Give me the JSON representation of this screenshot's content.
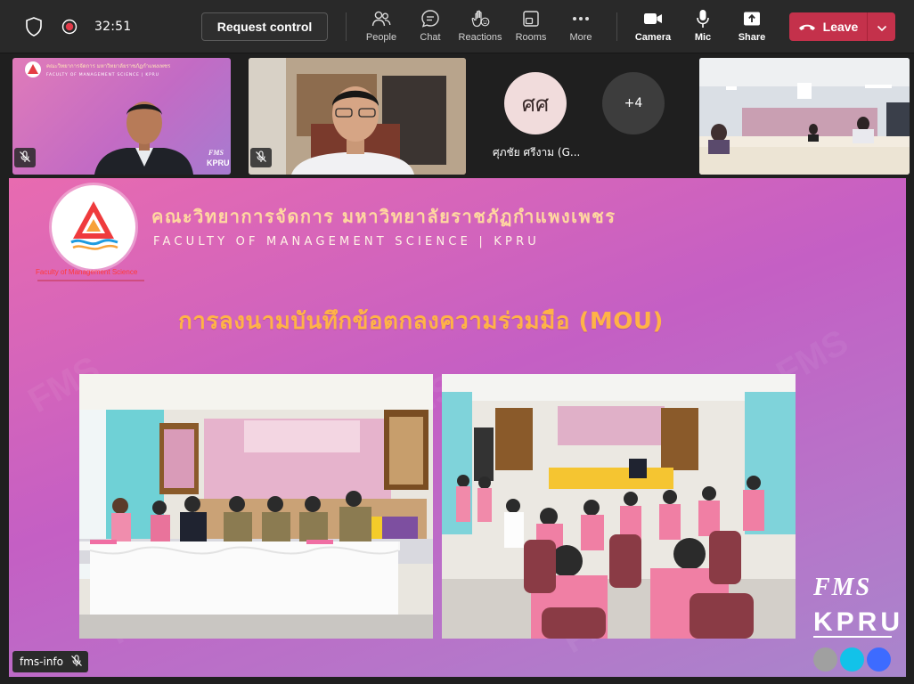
{
  "toolbar": {
    "timer": "32:51",
    "request_control": "Request control",
    "tools": [
      {
        "label": "People",
        "icon": "people-icon"
      },
      {
        "label": "Chat",
        "icon": "chat-icon"
      },
      {
        "label": "Reactions",
        "icon": "reactions-icon"
      },
      {
        "label": "Rooms",
        "icon": "rooms-icon"
      },
      {
        "label": "More",
        "icon": "more-icon"
      },
      {
        "label": "Camera",
        "icon": "camera-icon"
      },
      {
        "label": "Mic",
        "icon": "mic-icon"
      },
      {
        "label": "Share",
        "icon": "share-icon"
      }
    ],
    "leave_label": "Leave"
  },
  "participants": {
    "initials": "ศศ",
    "name": "ศุภชัย ศรีงาม (G...",
    "overflow": "+4",
    "tile1_header_th": "คณะวิทยาการจัดการ  มหาวิทยาลัยราชภัฏกำแพงเพชร",
    "tile1_header_en": "FACULTY OF MANAGEMENT SCIENCE | KPRU"
  },
  "slide": {
    "title_th": "คณะวิทยาการจัดการ  มหาวิทยาลัยราชภัฏกำแพงเพชร",
    "title_en": "FACULTY OF MANAGEMENT SCIENCE | KPRU",
    "logo_caption": "Faculty of Management Science",
    "mou_title": "การลงนามบันทึกข้อตกลงความร่วมมือ (MOU)",
    "brand_top": "FMS",
    "brand_bottom": "KPRU",
    "dot_colors": [
      "#a0a0a0",
      "#12c2e9",
      "#3d6bff"
    ]
  },
  "share_tag": {
    "label": "fms-info"
  },
  "colors": {
    "leave": "#c4314b",
    "toolbar": "#292929",
    "mou_title": "#ffb347"
  }
}
